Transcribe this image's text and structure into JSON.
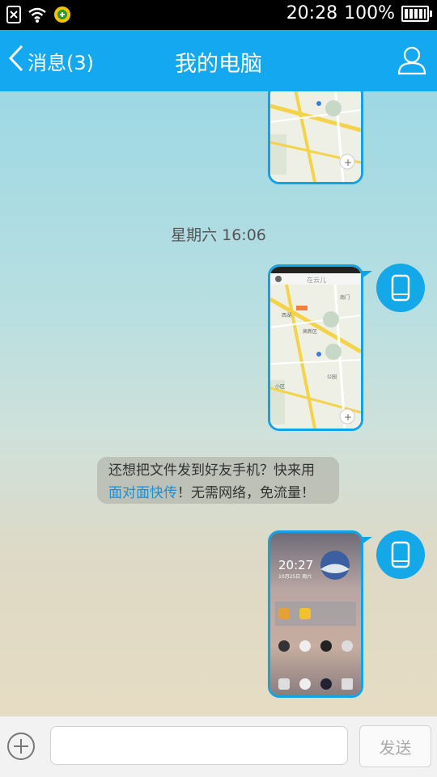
{
  "status_bar": {
    "time": "20:28",
    "battery": "100%",
    "icons": [
      "sim-icon",
      "wifi-icon",
      "app-notification-icon",
      "battery-icon"
    ]
  },
  "header": {
    "back_label": "消息(3)",
    "title": "我的电脑",
    "profile_icon": "person-icon"
  },
  "chat": {
    "timestamp": "星期六 16:06",
    "map_preview": {
      "title": "在云儿",
      "labels": [
        "高新区",
        "南门",
        "小区",
        "西湖",
        "公园"
      ]
    },
    "notice": {
      "line1": "还想把文件发到好友手机？快来用",
      "link": "面对面快传",
      "line2_rest": "！无需网络，免流量！"
    },
    "phone_preview": {
      "clock": "20:27",
      "date": "10月25日 周六"
    },
    "sender_avatar_icon": "phone-icon"
  },
  "input_bar": {
    "placeholder": "",
    "value": "",
    "send_label": "发送",
    "plus_icon": "plus-icon"
  },
  "colors": {
    "header_blue": "#14a8f0",
    "bubble_border": "#10a3e6",
    "link_blue": "#1a8fd6"
  }
}
